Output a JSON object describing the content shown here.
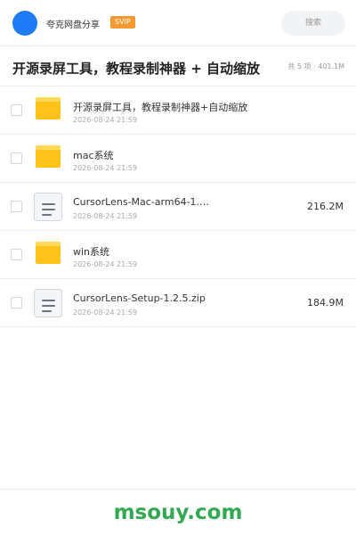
{
  "header": {
    "app_name": "夸克网盘分享",
    "badge": "SVIP",
    "search_placeholder": "搜索",
    "avatar_color": "#1e7bf5"
  },
  "folder": {
    "title": "开源录屏工具，教程录制神器 + 自动缩放",
    "summary": "共 5 项 · 401.1M"
  },
  "files": [
    {
      "type": "folder",
      "name": "开源录屏工具，教程录制神器+自动缩放",
      "date": "2026-08-24 21:59",
      "size": ""
    },
    {
      "type": "folder",
      "name": "mac系统",
      "date": "2026-08-24 21:59",
      "size": ""
    },
    {
      "type": "file",
      "name": "CursorLens-Mac-arm64-1.2.…",
      "date": "2026-08-24 21:59",
      "size": "216.2M"
    },
    {
      "type": "folder",
      "name": "win系统",
      "date": "2026-08-24 21:59",
      "size": ""
    },
    {
      "type": "file",
      "name": "CursorLens-Setup-1.2.5.zip",
      "date": "2026-08-24 21:59",
      "size": "184.9M"
    }
  ],
  "watermark": "msouy.com",
  "colors": {
    "folder_yellow": "#ffc21a",
    "badge_orange": "#f59a33",
    "watermark_green": "#33a852"
  }
}
